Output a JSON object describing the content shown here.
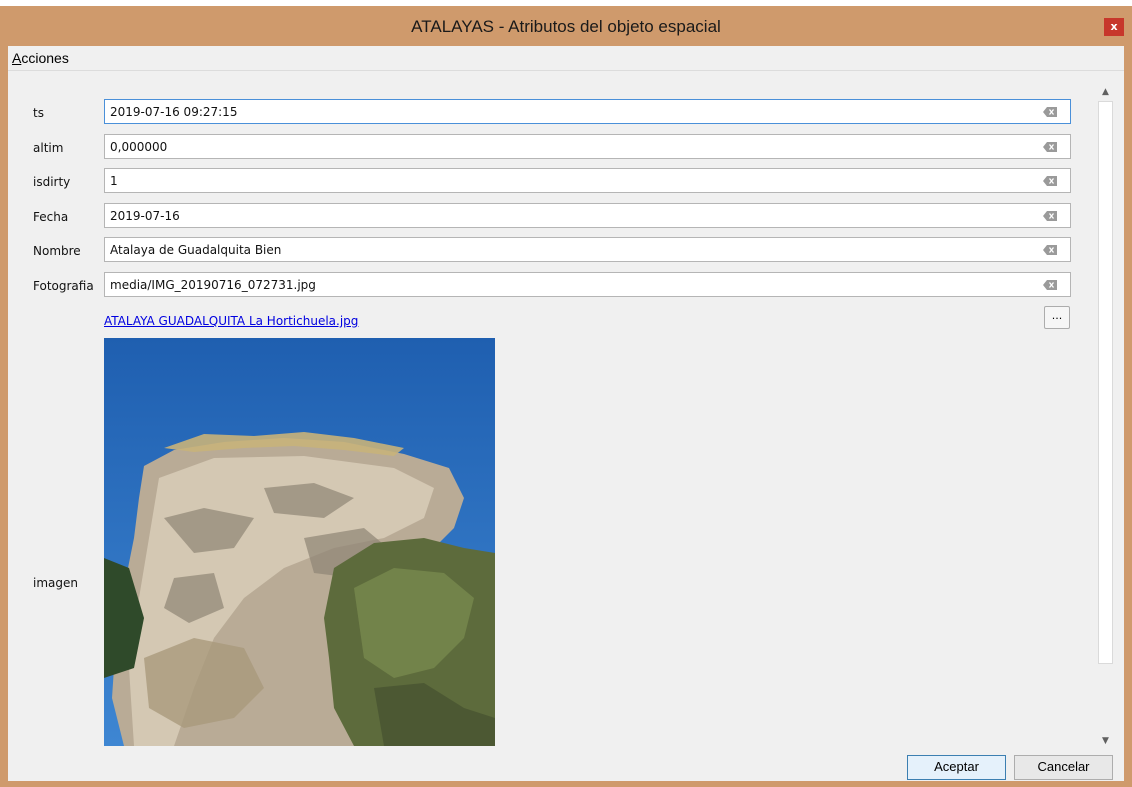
{
  "window": {
    "title": "ATALAYAS - Atributos del objeto espacial",
    "close_glyph": "x"
  },
  "menu": {
    "acciones_mnemonic": "A",
    "acciones_rest": "cciones"
  },
  "fields": [
    {
      "label": "ts",
      "value": "2019-07-16 09:27:15"
    },
    {
      "label": "altim",
      "value": "0,000000"
    },
    {
      "label": "isdirty",
      "value": "1"
    },
    {
      "label": "Fecha",
      "value": "2019-07-16"
    },
    {
      "label": "Nombre",
      "value": "Atalaya de Guadalquita Bien"
    },
    {
      "label": "Fotografia",
      "value": "media/IMG_20190716_072731.jpg"
    }
  ],
  "imagen": {
    "label": "imagen",
    "link_text": "ATALAYA GUADALQUITA La Hortichuela.jpg",
    "browse_label": "..."
  },
  "buttons": {
    "accept": "Aceptar",
    "cancel": "Cancelar"
  },
  "colors": {
    "frame": "#cf9a6c",
    "close": "#c7372b",
    "link": "#0000e0",
    "sky": "#2a6fc0"
  }
}
